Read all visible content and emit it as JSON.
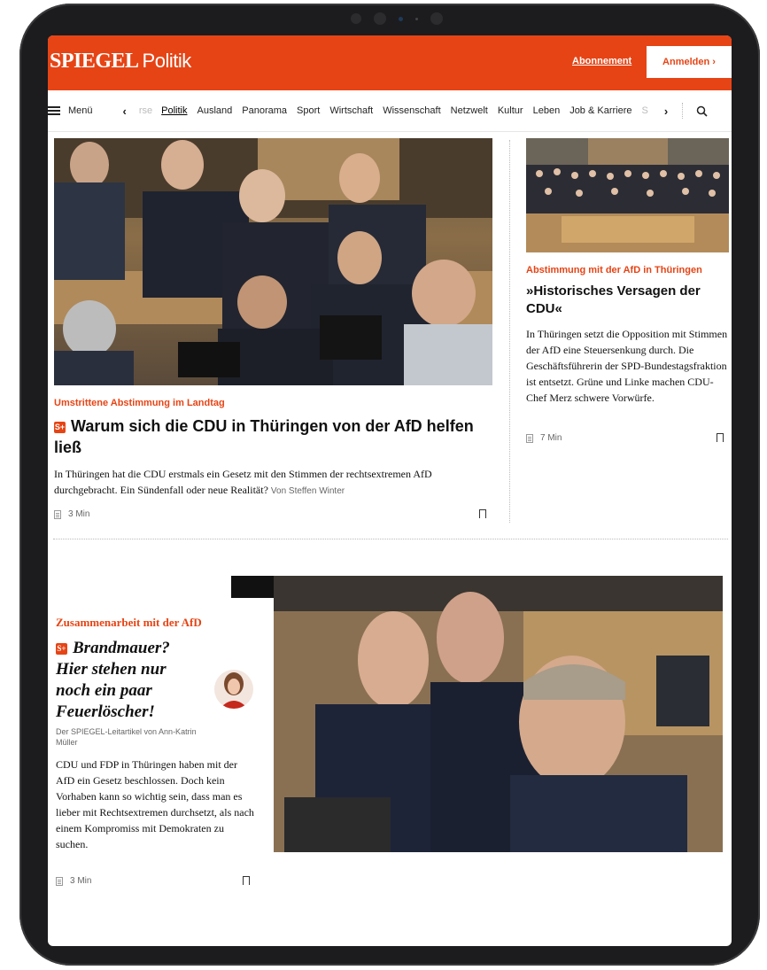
{
  "header": {
    "logo": "SPIEGEL",
    "section": "Politik",
    "subscribe": "Abonnement",
    "login": "Anmelden ›"
  },
  "nav": {
    "menu": "Menü",
    "left_arrow": "‹",
    "faded_left": "rse",
    "items": [
      "Politik",
      "Ausland",
      "Panorama",
      "Sport",
      "Wirtschaft",
      "Wissenschaft",
      "Netzwelt",
      "Kultur",
      "Leben",
      "Job & Karriere"
    ],
    "faded_right": "S",
    "right_arrow": "›",
    "active_index": 0
  },
  "main_article": {
    "kicker": "Umstrittene Abstimmung im Landtag",
    "plus": "S+",
    "title": "Warum sich die CDU in Thüringen von der AfD helfen ließ",
    "teaser": "In Thüringen hat die CDU erstmals ein Gesetz mit den Stimmen der rechtsextremen AfD durchgebracht. Ein Sündenfall oder neue Realität?",
    "author": "Von Steffen Winter",
    "read_time": "3 Min"
  },
  "side_article": {
    "kicker": "Abstimmung mit der AfD in Thüringen",
    "title": "»Historisches Versagen der CDU«",
    "teaser": "In Thüringen setzt die Opposition mit Stimmen der AfD eine Steuersenkung durch. Die Geschäftsführerin der SPD-Bundestagsfraktion ist entsetzt. Grüne und Linke machen CDU-Chef Merz schwere Vorwürfe.",
    "read_time": "7 Min"
  },
  "opinion_article": {
    "kicker": "Zusammenarbeit mit der AfD",
    "plus": "S+",
    "title": "Brandmauer? Hier stehen nur noch ein paar Feuerlöscher!",
    "byline": "Der SPIEGEL-Leitartikel von Ann-Katrin Müller",
    "teaser": "CDU und FDP in Thüringen haben mit der AfD ein Gesetz beschlossen. Doch kein Vorhaben kann so wichtig sein, dass man es lieber mit Rechtsextremen durchsetzt, als nach einem Kompromiss mit Demokraten zu suchen.",
    "read_time": "3 Min"
  },
  "colors": {
    "brand": "#e64415"
  }
}
